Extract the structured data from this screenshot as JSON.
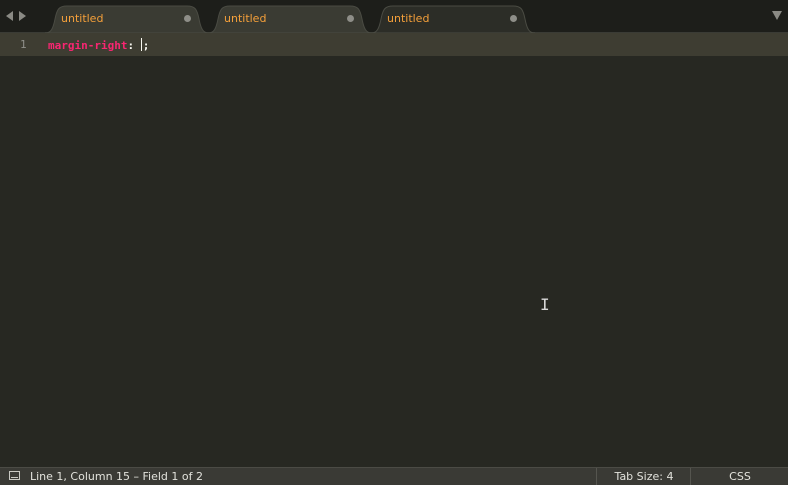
{
  "tabs": [
    {
      "label": "untitled"
    },
    {
      "label": "untitled"
    },
    {
      "label": "untitled"
    }
  ],
  "editor": {
    "line_number": "1",
    "property": "margin-right",
    "colon": ": ",
    "semicolon": ";"
  },
  "status": {
    "position_text": "Line 1, Column 15 – Field 1 of 2",
    "tab_size": "Tab Size: 4",
    "syntax": "CSS"
  },
  "colors": {
    "background": "#272822",
    "tab_label": "#f5a03a",
    "property": "#f92672",
    "line_highlight": "#3e3d32"
  },
  "icons": {
    "nav_back": "chevron-left-icon",
    "nav_forward": "chevron-right-icon",
    "tab_modified": "dot-icon",
    "tab_overflow": "chevron-down-icon",
    "panel": "panel-icon"
  }
}
